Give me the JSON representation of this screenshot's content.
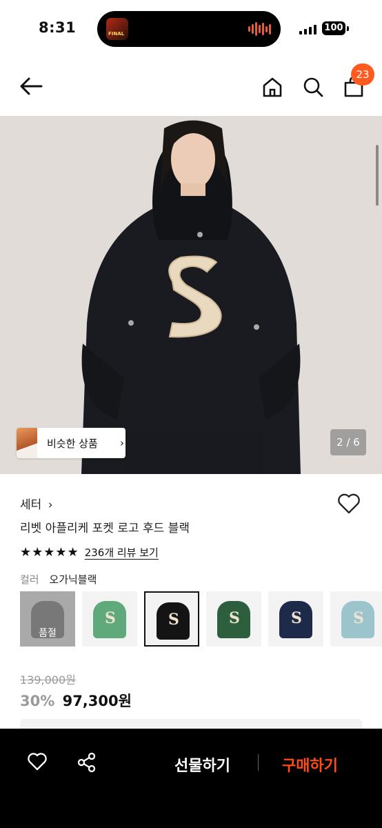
{
  "status_bar": {
    "time": "8:31",
    "battery": "100"
  },
  "header": {
    "cart_count": "23",
    "icons": [
      "back-arrow-icon",
      "home-icon",
      "search-icon",
      "cart-icon"
    ]
  },
  "gallery": {
    "similar_label": "비슷한 상품",
    "similar_chevron": "›",
    "pager": "2 / 6"
  },
  "product": {
    "brand": "세터",
    "brand_chevron": "›",
    "title": "리벳 아플리케 포켓 로고 후드 블랙",
    "stars": "★★★★★",
    "review_link": "236개 리뷰 보기",
    "color_label": "컬러",
    "color_value": "오가닉블랙",
    "swatches": [
      {
        "color": "#9a9a9a",
        "sold_out_label": "품절"
      },
      {
        "color": "#5fa97a"
      },
      {
        "color": "#141414"
      },
      {
        "color": "#2d5e3e"
      },
      {
        "color": "#1d2a4a"
      },
      {
        "color": "#9cc4cc"
      }
    ],
    "original_price": "139,000원",
    "discount": "30%",
    "price": "97,300원"
  },
  "action_bar": {
    "gift_label": "선물하기",
    "buy_label": "구매하기",
    "accent": "#ff4b14"
  }
}
